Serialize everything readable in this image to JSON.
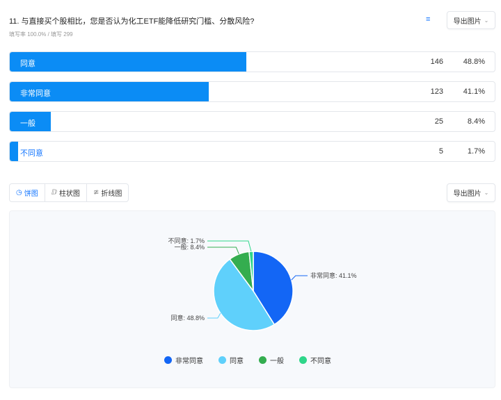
{
  "question": {
    "title": "11. 与直接买个股相比，您是否认为化工ETF能降低研究门槛、分散风险?",
    "subtitle": "填写率 100.0% / 填写 299",
    "export_label": "导出图片",
    "sort_icon": "sort-icon"
  },
  "options": [
    {
      "label": "同意",
      "count": "146",
      "percent": "48.8%",
      "value": 48.8
    },
    {
      "label": "非常同意",
      "count": "123",
      "percent": "41.1%",
      "value": 41.1
    },
    {
      "label": "一般",
      "count": "25",
      "percent": "8.4%",
      "value": 8.4
    },
    {
      "label": "不同意",
      "count": "5",
      "percent": "1.7%",
      "value": 1.7
    }
  ],
  "chart_tabs": [
    {
      "label": "饼图",
      "icon": "pie-icon"
    },
    {
      "label": "柱状图",
      "icon": "bar-chart-icon"
    },
    {
      "label": "折线图",
      "icon": "line-chart-icon"
    }
  ],
  "chart_export_label": "导出图片",
  "chart_data": {
    "type": "pie",
    "slices": [
      {
        "name": "非常同意",
        "value": 41.1,
        "label": "非常同意: 41.1%",
        "color": "#1366f5"
      },
      {
        "name": "同意",
        "value": 48.8,
        "label": "同意: 48.8%",
        "color": "#5fd0fb"
      },
      {
        "name": "一般",
        "value": 8.4,
        "label": "一般: 8.4%",
        "color": "#34ad4f"
      },
      {
        "name": "不同意",
        "value": 1.7,
        "label": "不同意: 1.7%",
        "color": "#2fd68a"
      }
    ],
    "legend": [
      "非常同意",
      "同意",
      "一般",
      "不同意"
    ],
    "legend_position": "bottom"
  }
}
